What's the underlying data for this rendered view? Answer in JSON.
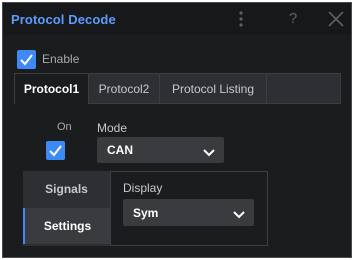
{
  "window": {
    "title": "Protocol Decode",
    "icons": [
      "kebab-menu-icon",
      "help-icon",
      "close-icon"
    ],
    "help_glyph": "?"
  },
  "enable": {
    "label": "Enable",
    "checked": true
  },
  "tabs": [
    {
      "label": "Protocol1",
      "active": true
    },
    {
      "label": "Protocol2",
      "active": false
    },
    {
      "label": "Protocol Listing",
      "active": false
    }
  ],
  "on": {
    "label": "On",
    "checked": true
  },
  "mode": {
    "label": "Mode",
    "value": "CAN"
  },
  "side_tabs": [
    {
      "label": "Signals",
      "active": false
    },
    {
      "label": "Settings",
      "active": true
    }
  ],
  "display": {
    "label": "Display",
    "value": "Sym"
  },
  "colors": {
    "accent": "#3d8af7",
    "title": "#5d9cff",
    "background": "#1b1c1e",
    "panel": "#2e2f32",
    "control": "#3a3b3e"
  }
}
